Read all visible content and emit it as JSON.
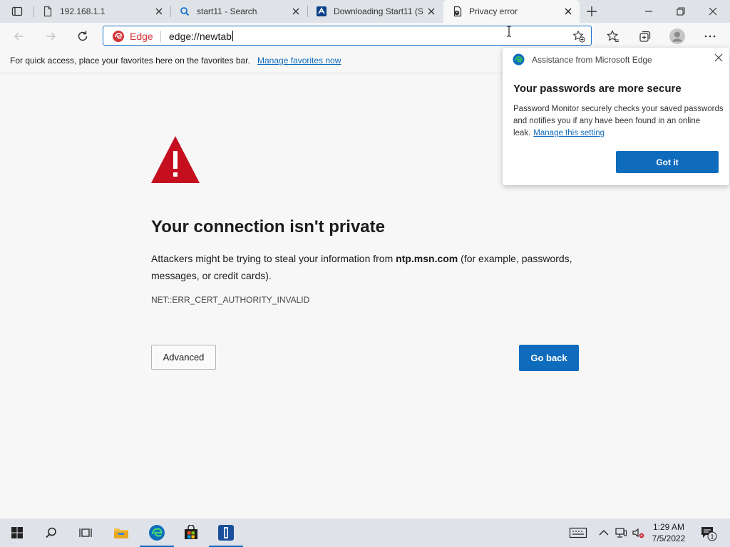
{
  "tabs": [
    {
      "title": "192.168.1.1",
      "icon": "page-icon"
    },
    {
      "title": "start11 - Search",
      "icon": "search-icon"
    },
    {
      "title": "Downloading Start11 (S",
      "icon": "stardock-icon"
    },
    {
      "title": "Privacy error",
      "icon": "privacy-error-icon",
      "active": true
    }
  ],
  "address_bar": {
    "site_label": "Edge",
    "url": "edge://newtab"
  },
  "favorites_bar": {
    "message": "For quick access, place your favorites here on the favorites bar.",
    "link": "Manage favorites now"
  },
  "error_page": {
    "title": "Your connection isn't private",
    "body_before": "Attackers might be trying to steal your information from ",
    "host": "ntp.msn.com",
    "body_after": " (for example, passwords, messages, or credit cards).",
    "error_code": "NET::ERR_CERT_AUTHORITY_INVALID",
    "advanced_label": "Advanced",
    "go_back_label": "Go back"
  },
  "flyout": {
    "header": "Assistance from Microsoft Edge",
    "title": "Your passwords are more secure",
    "body": "Password Monitor securely checks your saved passwords and notifies you if any have been found in an online leak.",
    "link": "Manage this setting",
    "button": "Got it"
  },
  "taskbar": {
    "time": "1:29 AM",
    "date": "7/5/2022",
    "notification_count": "1"
  },
  "colors": {
    "accent": "#0f6cbd",
    "warning_red": "#c50f1f",
    "edge_label": "#d13438"
  }
}
